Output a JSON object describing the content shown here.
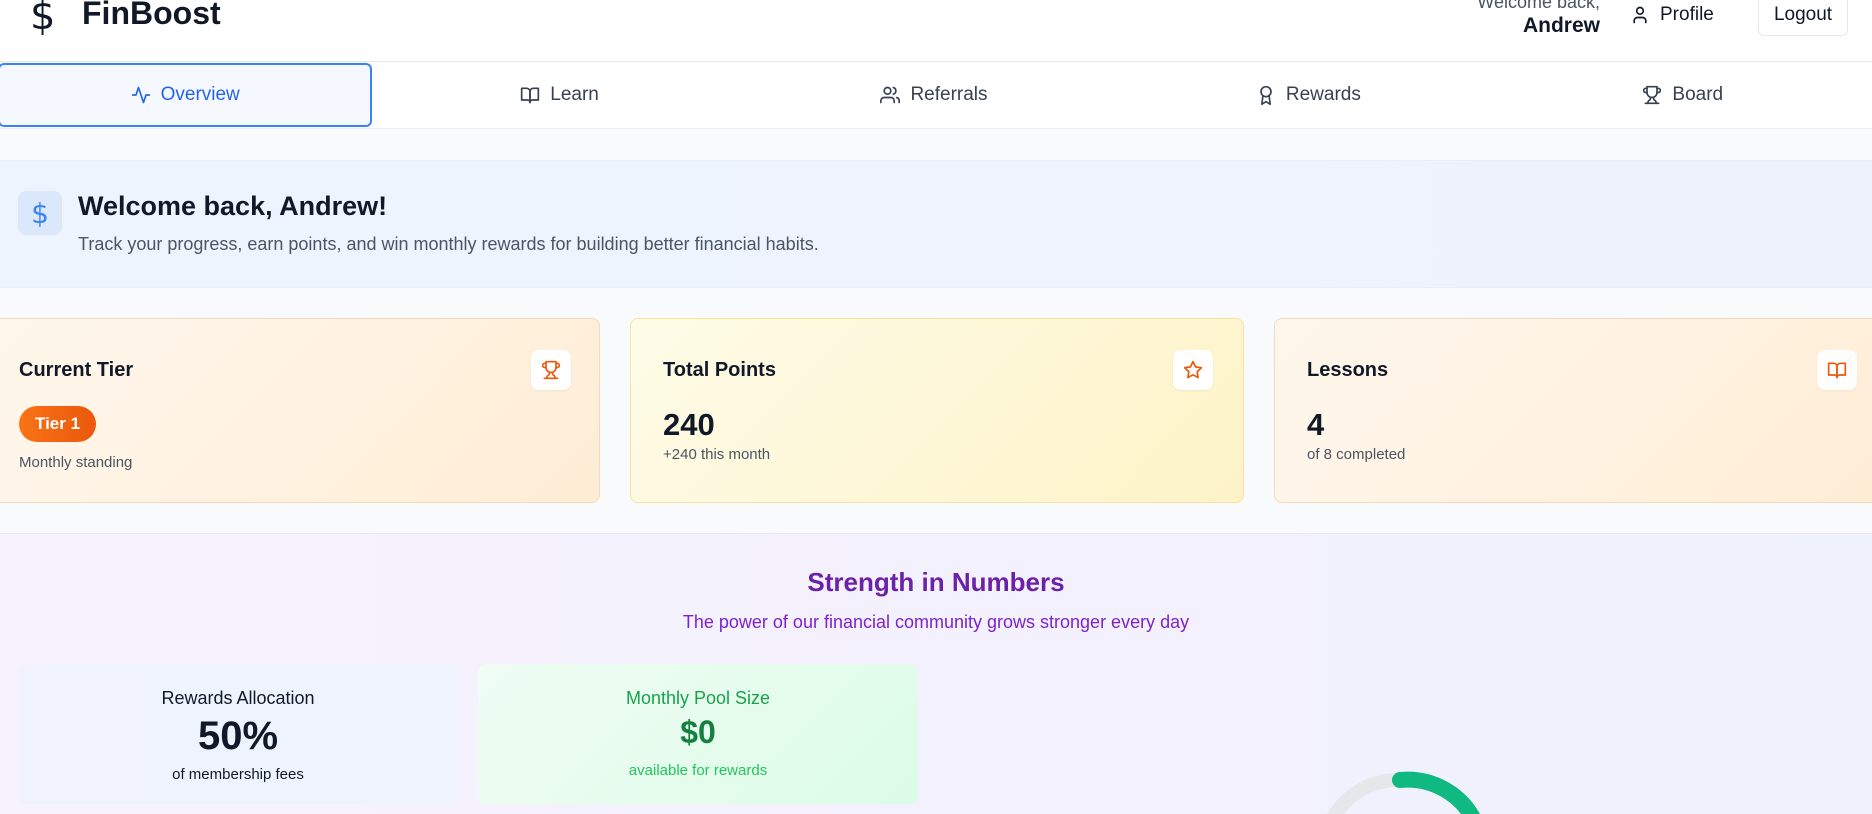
{
  "header": {
    "brand_icon": "$",
    "brand_name": "FinBoost",
    "welcome_label": "Welcome back,",
    "user_name": "Andrew",
    "profile_label": "Profile",
    "logout_label": "Logout"
  },
  "tabs": [
    {
      "label": "Overview",
      "icon": "activity-icon",
      "active": true
    },
    {
      "label": "Learn",
      "icon": "book-icon",
      "active": false
    },
    {
      "label": "Referrals",
      "icon": "users-icon",
      "active": false
    },
    {
      "label": "Rewards",
      "icon": "award-icon",
      "active": false
    },
    {
      "label": "Board",
      "icon": "trophy-icon",
      "active": false
    }
  ],
  "banner": {
    "icon": "$",
    "title": "Welcome back, Andrew!",
    "subtitle": "Track your progress, earn points, and win monthly rewards for building better financial habits."
  },
  "cards": {
    "tier": {
      "title": "Current Tier",
      "badge": "Tier 1",
      "note": "Monthly standing",
      "icon": "trophy-icon"
    },
    "points": {
      "title": "Total Points",
      "value": "240",
      "note": "+240 this month",
      "icon": "star-icon"
    },
    "lessons": {
      "title": "Lessons",
      "value": "4",
      "note": "of 8 completed",
      "icon": "book-icon"
    }
  },
  "community": {
    "title": "Strength in Numbers",
    "subtitle": "The power of our financial community grows stronger every day",
    "allocation": {
      "label": "Rewards Allocation",
      "value": "50%",
      "note": "of membership fees"
    },
    "pool": {
      "label": "Monthly Pool Size",
      "value": "$0",
      "note": "available for rewards"
    }
  },
  "colors": {
    "accent": "#3b82f6",
    "tier_badge": "#f97316",
    "community_title": "#6b21a8",
    "pool_green": "#15803d",
    "gauge_green": "#10b981"
  }
}
